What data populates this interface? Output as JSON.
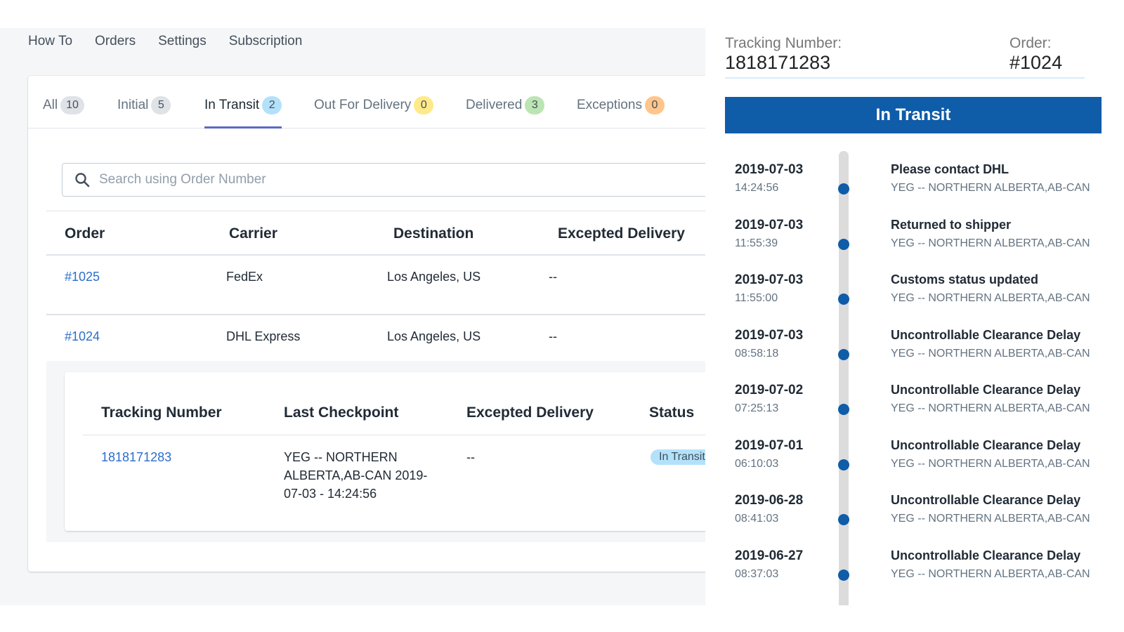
{
  "nav": {
    "items": [
      "How To",
      "Orders",
      "Settings",
      "Subscription"
    ]
  },
  "tabs": [
    {
      "label": "All",
      "count": "10",
      "color": "#dfe3e8",
      "active": false
    },
    {
      "label": "Initial",
      "count": "5",
      "color": "#dfe3e8",
      "active": false
    },
    {
      "label": "In Transit",
      "count": "2",
      "color": "#b4e1fa",
      "active": true
    },
    {
      "label": "Out For Delivery",
      "count": "0",
      "color": "#ffea8a",
      "active": false
    },
    {
      "label": "Delivered",
      "count": "3",
      "color": "#bbe5b3",
      "active": false
    },
    {
      "label": "Exceptions",
      "count": "0",
      "color": "#ffc58b",
      "active": false
    }
  ],
  "search": {
    "placeholder": "Search using Order Number",
    "value": ""
  },
  "orders_table": {
    "columns": [
      "Order",
      "Carrier",
      "Destination",
      "Excepted Delivery"
    ],
    "rows": [
      {
        "order": "#1025",
        "carrier": "FedEx",
        "destination": "Los Angeles, US",
        "expected": "--"
      },
      {
        "order": "#1024",
        "carrier": "DHL Express",
        "destination": "Los Angeles, US",
        "expected": "--"
      }
    ]
  },
  "tracking_table": {
    "columns": [
      "Tracking Number",
      "Last Checkpoint",
      "Excepted Delivery",
      "Status"
    ],
    "row": {
      "tracking_number": "1818171283",
      "last_checkpoint_lines": [
        "YEG -- NORTHERN",
        "ALBERTA,AB-CAN 2019-",
        "07-03 - 14:24:56"
      ],
      "expected": "--",
      "status": "In Transit"
    }
  },
  "panel": {
    "tracking_label": "Tracking Number:",
    "tracking_number": "1818171283",
    "order_label": "Order:",
    "order_number": "#1024",
    "status": "In Transit",
    "accent_color": "#0f5ca8",
    "events": [
      {
        "date": "2019-07-03",
        "time": "14:24:56",
        "title": "Please contact DHL",
        "location": "YEG -- NORTHERN ALBERTA,AB-CAN"
      },
      {
        "date": "2019-07-03",
        "time": "11:55:39",
        "title": "Returned to shipper",
        "location": "YEG -- NORTHERN ALBERTA,AB-CAN"
      },
      {
        "date": "2019-07-03",
        "time": "11:55:00",
        "title": "Customs status updated",
        "location": "YEG -- NORTHERN ALBERTA,AB-CAN"
      },
      {
        "date": "2019-07-03",
        "time": "08:58:18",
        "title": "Uncontrollable Clearance Delay",
        "location": "YEG -- NORTHERN ALBERTA,AB-CAN"
      },
      {
        "date": "2019-07-02",
        "time": "07:25:13",
        "title": "Uncontrollable Clearance Delay",
        "location": "YEG -- NORTHERN ALBERTA,AB-CAN"
      },
      {
        "date": "2019-07-01",
        "time": "06:10:03",
        "title": "Uncontrollable Clearance Delay",
        "location": "YEG -- NORTHERN ALBERTA,AB-CAN"
      },
      {
        "date": "2019-06-28",
        "time": "08:41:03",
        "title": "Uncontrollable Clearance Delay",
        "location": "YEG -- NORTHERN ALBERTA,AB-CAN"
      },
      {
        "date": "2019-06-27",
        "time": "08:37:03",
        "title": "Uncontrollable Clearance Delay",
        "location": "YEG -- NORTHERN ALBERTA,AB-CAN"
      }
    ]
  }
}
